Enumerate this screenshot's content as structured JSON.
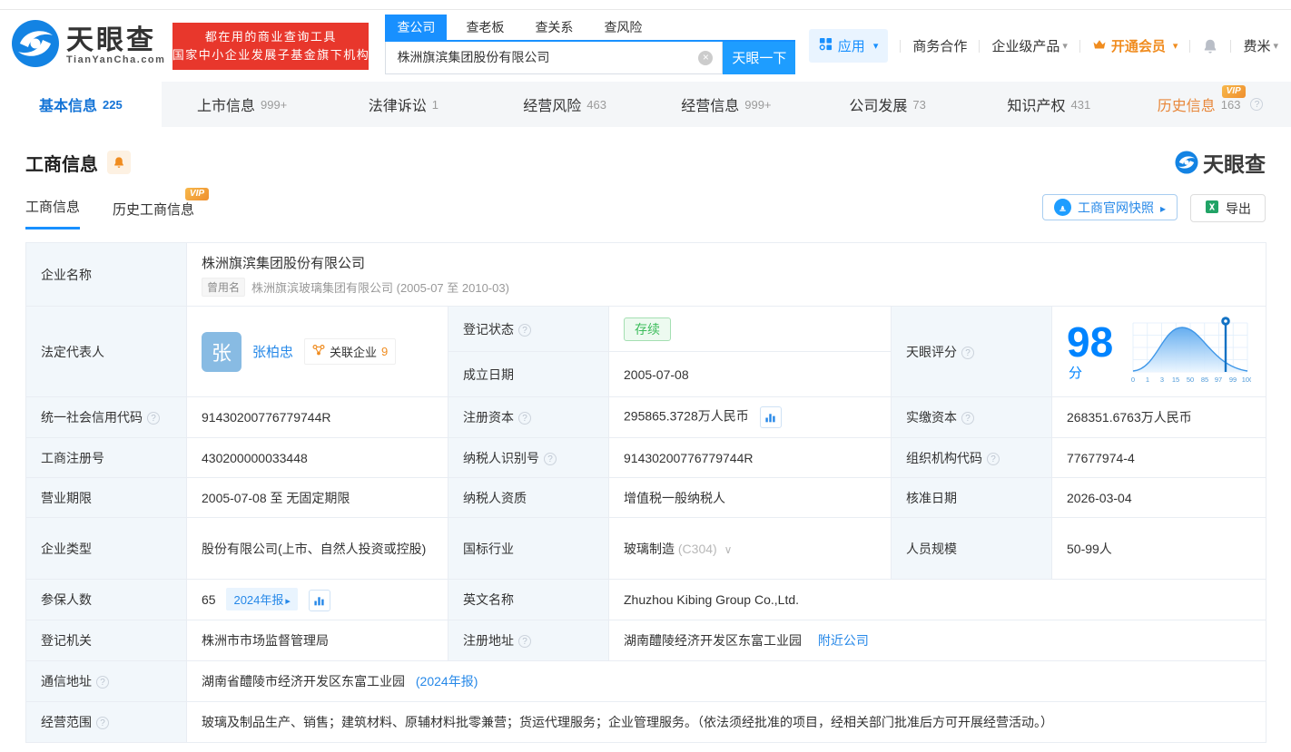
{
  "colors": {
    "brand_blue": "#1890ff",
    "link_blue": "#2688e8",
    "score_blue": "#0084ff",
    "vip_orange": "#f08c1f",
    "status_green": "#3dbd5c",
    "banner_red": "#e8372c"
  },
  "vip_label": "VIP",
  "header": {
    "logo": {
      "name": "天眼查",
      "domain": "TianYanCha.com"
    },
    "banner": {
      "line1": "都在用的商业查询工具",
      "line2": "国家中小企业发展子基金旗下机构"
    },
    "search": {
      "tabs": [
        {
          "label": "查公司",
          "active": true
        },
        {
          "label": "查老板",
          "active": false
        },
        {
          "label": "查关系",
          "active": false
        },
        {
          "label": "查风险",
          "active": false
        }
      ],
      "value": "株洲旗滨集团股份有限公司",
      "button": "天眼一下"
    },
    "nav": {
      "apps": "应用",
      "cooperation": "商务合作",
      "enterprise_products": "企业级产品",
      "vip": "开通会员",
      "username": "费米"
    }
  },
  "tabs": [
    {
      "label": "基本信息",
      "count": "225",
      "active": true
    },
    {
      "label": "上市信息",
      "count": "999+"
    },
    {
      "label": "法律诉讼",
      "count": "1"
    },
    {
      "label": "经营风险",
      "count": "463"
    },
    {
      "label": "经营信息",
      "count": "999+"
    },
    {
      "label": "公司发展",
      "count": "73"
    },
    {
      "label": "知识产权",
      "count": "431"
    },
    {
      "label": "历史信息",
      "count": "163",
      "vip": true
    }
  ],
  "section": {
    "title": "工商信息",
    "subtabs": [
      {
        "label": "工商信息",
        "active": true
      },
      {
        "label": "历史工商信息",
        "vip": true
      }
    ],
    "snapshot_button": "工商官网快照",
    "export_button": "导出",
    "watermark": "天眼查"
  },
  "company": {
    "name_label": "企业名称",
    "name": "株洲旗滨集团股份有限公司",
    "former_tag": "曾用名",
    "former_name": "株洲旗滨玻璃集团有限公司 (2005-07 至 2010-03)",
    "legal_rep_label": "法定代表人",
    "legal_rep_avatar": "张",
    "legal_rep_name": "张柏忠",
    "related_label": "关联企业",
    "related_count": "9"
  },
  "score": {
    "label": "天眼评分",
    "value": "98",
    "unit": "分",
    "axis": [
      "0",
      "1",
      "3",
      "15",
      "50",
      "85",
      "97",
      "99",
      "100"
    ]
  },
  "fields": {
    "reg_status": {
      "label": "登记状态",
      "value": "存续"
    },
    "est_date": {
      "label": "成立日期",
      "value": "2005-07-08"
    },
    "credit_code": {
      "label": "统一社会信用代码",
      "value": "91430200776779744R"
    },
    "reg_capital": {
      "label": "注册资本",
      "value": "295865.3728万人民币"
    },
    "paid_capital": {
      "label": "实缴资本",
      "value": "268351.6763万人民币"
    },
    "reg_no": {
      "label": "工商注册号",
      "value": "430200000033448"
    },
    "taxpayer_id": {
      "label": "纳税人识别号",
      "value": "91430200776779744R"
    },
    "org_code": {
      "label": "组织机构代码",
      "value": "77677974-4"
    },
    "term": {
      "label": "营业期限",
      "value": "2005-07-08 至 无固定期限"
    },
    "taxpayer_quality": {
      "label": "纳税人资质",
      "value": "增值税一般纳税人"
    },
    "approval_date": {
      "label": "核准日期",
      "value": "2026-03-04"
    },
    "company_type": {
      "label": "企业类型",
      "value": "股份有限公司(上市、自然人投资或控股)"
    },
    "industry": {
      "label": "国标行业",
      "value": "玻璃制造",
      "code": "(C304)"
    },
    "staff_size": {
      "label": "人员规模",
      "value": "50-99人"
    },
    "insured": {
      "label": "参保人数",
      "value": "65",
      "tag": "2024年报"
    },
    "english_name": {
      "label": "英文名称",
      "value": "Zhuzhou Kibing Group Co.,Ltd."
    },
    "reg_authority": {
      "label": "登记机关",
      "value": "株洲市市场监督管理局"
    },
    "reg_address": {
      "label": "注册地址",
      "value": "湖南醴陵经济开发区东富工业园",
      "link": "附近公司"
    },
    "mail_address": {
      "label": "通信地址",
      "value": "湖南省醴陵市经济开发区东富工业园",
      "link": "(2024年报)"
    },
    "scope": {
      "label": "经营范围",
      "value": "玻璃及制品生产、销售；建筑材料、原辅材料批零兼营；货运代理服务；企业管理服务。（依法须经批准的项目，经相关部门批准后方可开展经营活动。）"
    }
  }
}
